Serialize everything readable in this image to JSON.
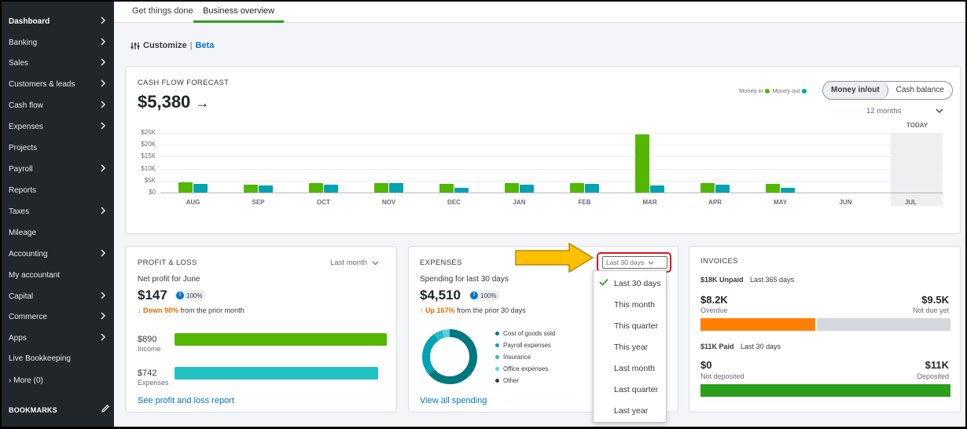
{
  "sidebar": {
    "items": [
      {
        "label": "Dashboard",
        "chevron": true
      },
      {
        "label": "Banking",
        "chevron": true
      },
      {
        "label": "Sales",
        "chevron": true
      },
      {
        "label": "Customers & leads",
        "chevron": true
      },
      {
        "label": "Cash flow",
        "chevron": true
      },
      {
        "label": "Expenses",
        "chevron": true
      },
      {
        "label": "Projects",
        "chevron": false
      },
      {
        "label": "Payroll",
        "chevron": true
      },
      {
        "label": "Reports",
        "chevron": false
      },
      {
        "label": "Taxes",
        "chevron": true
      },
      {
        "label": "Mileage",
        "chevron": false
      },
      {
        "label": "Accounting",
        "chevron": true
      },
      {
        "label": "My accountant",
        "chevron": false
      },
      {
        "label": "Capital",
        "chevron": true
      },
      {
        "label": "Commerce",
        "chevron": true
      },
      {
        "label": "Apps",
        "chevron": true
      },
      {
        "label": "Live Bookkeeping",
        "chevron": false
      },
      {
        "label": "›  More (0)",
        "chevron": false
      }
    ],
    "bookmarks_label": "BOOKMARKS"
  },
  "tabs": {
    "get_things_done": "Get things done",
    "business_overview": "Business overview"
  },
  "customize": {
    "label": "Customize",
    "separator": "|",
    "beta": "Beta"
  },
  "cash_flow": {
    "title": "CASH FLOW FORECAST",
    "amount": "$5,380",
    "arrow": "→",
    "legend_in": "Money in",
    "legend_out": "Money out",
    "toggle_on": "Money in/out",
    "toggle_off": "Cash balance",
    "range": "12 months",
    "today": "TODAY",
    "colors": {
      "money_in": "#53b700",
      "money_out": "#00a3b1"
    }
  },
  "chart_data": {
    "type": "bar",
    "categories": [
      "AUG",
      "SEP",
      "OCT",
      "NOV",
      "DEC",
      "JAN",
      "FEB",
      "MAR",
      "APR",
      "MAY",
      "JUN",
      "JUL"
    ],
    "series": [
      {
        "name": "Money in",
        "values": [
          4200,
          3200,
          4000,
          3800,
          3500,
          3800,
          4100,
          24500,
          4100,
          3600,
          0,
          0
        ]
      },
      {
        "name": "Money out",
        "values": [
          3600,
          2900,
          3400,
          4100,
          2000,
          3300,
          3600,
          2900,
          3400,
          2000,
          0,
          0
        ]
      }
    ],
    "yticks": [
      "$25K",
      "$20K",
      "$15K",
      "$10K",
      "$5K",
      "$0"
    ],
    "ylim": [
      0,
      25000
    ]
  },
  "profit_loss": {
    "title": "PROFIT & LOSS",
    "period": "Last month",
    "subtitle": "Net profit for June",
    "amount": "$147",
    "badge": "100%",
    "delta_strong": "Down 90%",
    "delta_rest": "from the prior month",
    "income_amount": "$890",
    "income_label": "Income",
    "expenses_amount": "$742",
    "expenses_label": "Expenses",
    "income_fraction": 1.0,
    "expenses_fraction": 0.96,
    "link": "See profit and loss report"
  },
  "expenses": {
    "title": "EXPENSES",
    "subtitle": "Spending for last 30 days",
    "amount": "$4,510",
    "badge": "100%",
    "delta_strong": "Up 167%",
    "delta_rest": "from the prior 30 days",
    "legend": [
      {
        "label": "Cost of goods sold",
        "color": "#00787f"
      },
      {
        "label": "Payroll expenses",
        "color": "#00a3b1"
      },
      {
        "label": "Insurance",
        "color": "#2ab8c6"
      },
      {
        "label": "Office expenses",
        "color": "#55d4dc"
      },
      {
        "label": "Other",
        "color": "#393a3d"
      }
    ],
    "link": "View all spending",
    "selected_period": "Last 30 days"
  },
  "period_menu": {
    "items": [
      "Last 30 days",
      "This month",
      "This quarter",
      "This year",
      "Last month",
      "Last quarter",
      "Last year"
    ],
    "selected": "Last 30 days"
  },
  "invoices": {
    "title": "INVOICES",
    "unpaid": "$18K Unpaid",
    "unpaid_period": "Last 365 days",
    "overdue_amount": "$8.2K",
    "overdue_label": "Overdue",
    "not_due_amount": "$9.5K",
    "not_due_label": "Not due yet",
    "paid": "$11K Paid",
    "paid_period": "Last 30 days",
    "not_deposited_amount": "$0",
    "not_deposited_label": "Not deposited",
    "deposited_amount": "$11K",
    "deposited_label": "Deposited",
    "colors": {
      "overdue": "#ff8000",
      "not_due": "#d4d7dc",
      "deposited": "#2ca01c"
    }
  }
}
